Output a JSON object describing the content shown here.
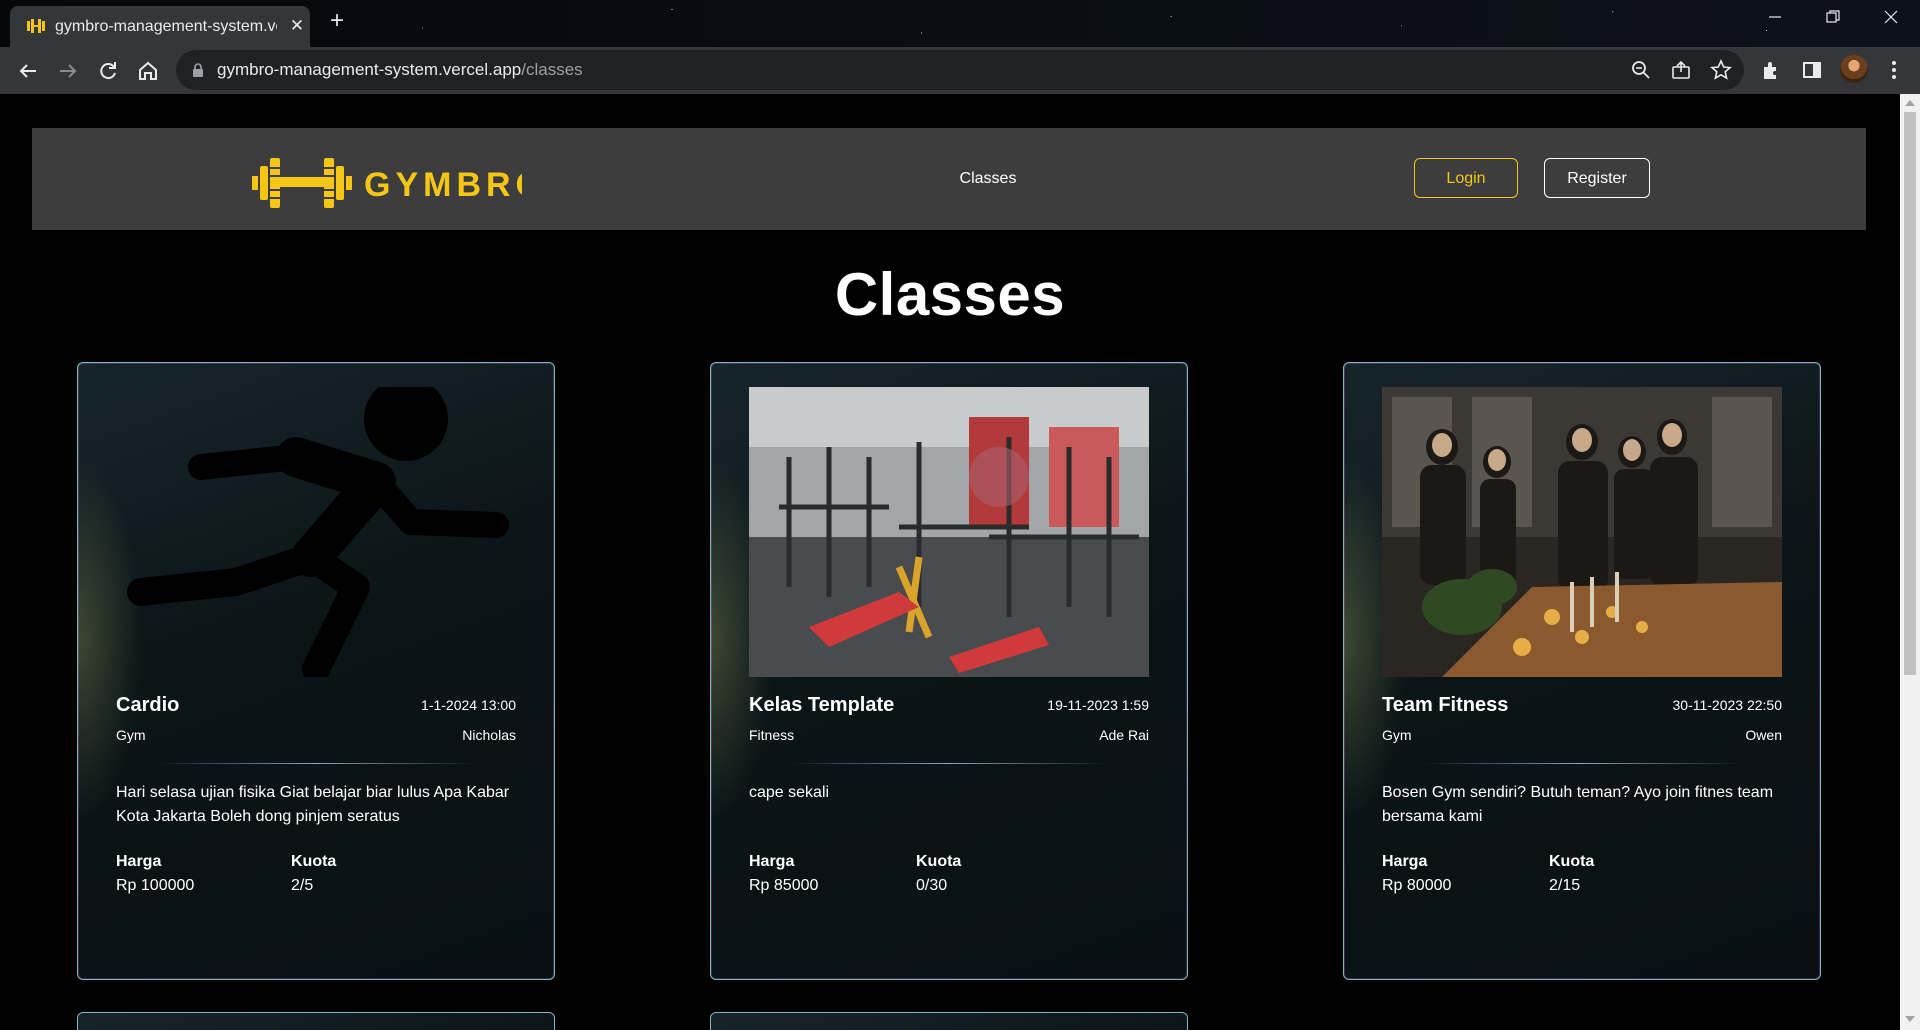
{
  "browser": {
    "tab_title": "gymbro-management-system.ve",
    "new_tab_symbol": "+",
    "close_symbol": "✕",
    "url_host": "gymbro-management-system.vercel.app",
    "url_path": "/classes"
  },
  "navbar": {
    "brand": "GYMBROS",
    "brand_color": "#f5c518",
    "links": [
      "Classes"
    ],
    "login_label": "Login",
    "register_label": "Register"
  },
  "page": {
    "title": "Classes"
  },
  "labels": {
    "price": "Harga",
    "quota": "Kuota"
  },
  "classes": [
    {
      "name": "Cardio",
      "datetime": "1-1-2024 13:00",
      "category": "Gym",
      "trainer": "Nicholas",
      "description": "Hari selasa ujian fisika Giat belajar biar lulus Apa Kabar Kota Jakarta Boleh dong pinjem seratus",
      "price": "Rp 100000",
      "quota": "2/5",
      "image": "running-person-icon"
    },
    {
      "name": "Kelas Template",
      "datetime": "19-11-2023 1:59",
      "category": "Fitness",
      "trainer": "Ade Rai",
      "description": "cape sekali",
      "price": "Rp 85000",
      "quota": "0/30",
      "image": "gym-equipment-photo"
    },
    {
      "name": "Team Fitness",
      "datetime": "30-11-2023 22:50",
      "category": "Gym",
      "trainer": "Owen",
      "description": "Bosen Gym sendiri? Butuh teman? Ayo join fitnes team bersama kami",
      "price": "Rp 80000",
      "quota": "2/15",
      "image": "people-gathering-photo"
    }
  ]
}
